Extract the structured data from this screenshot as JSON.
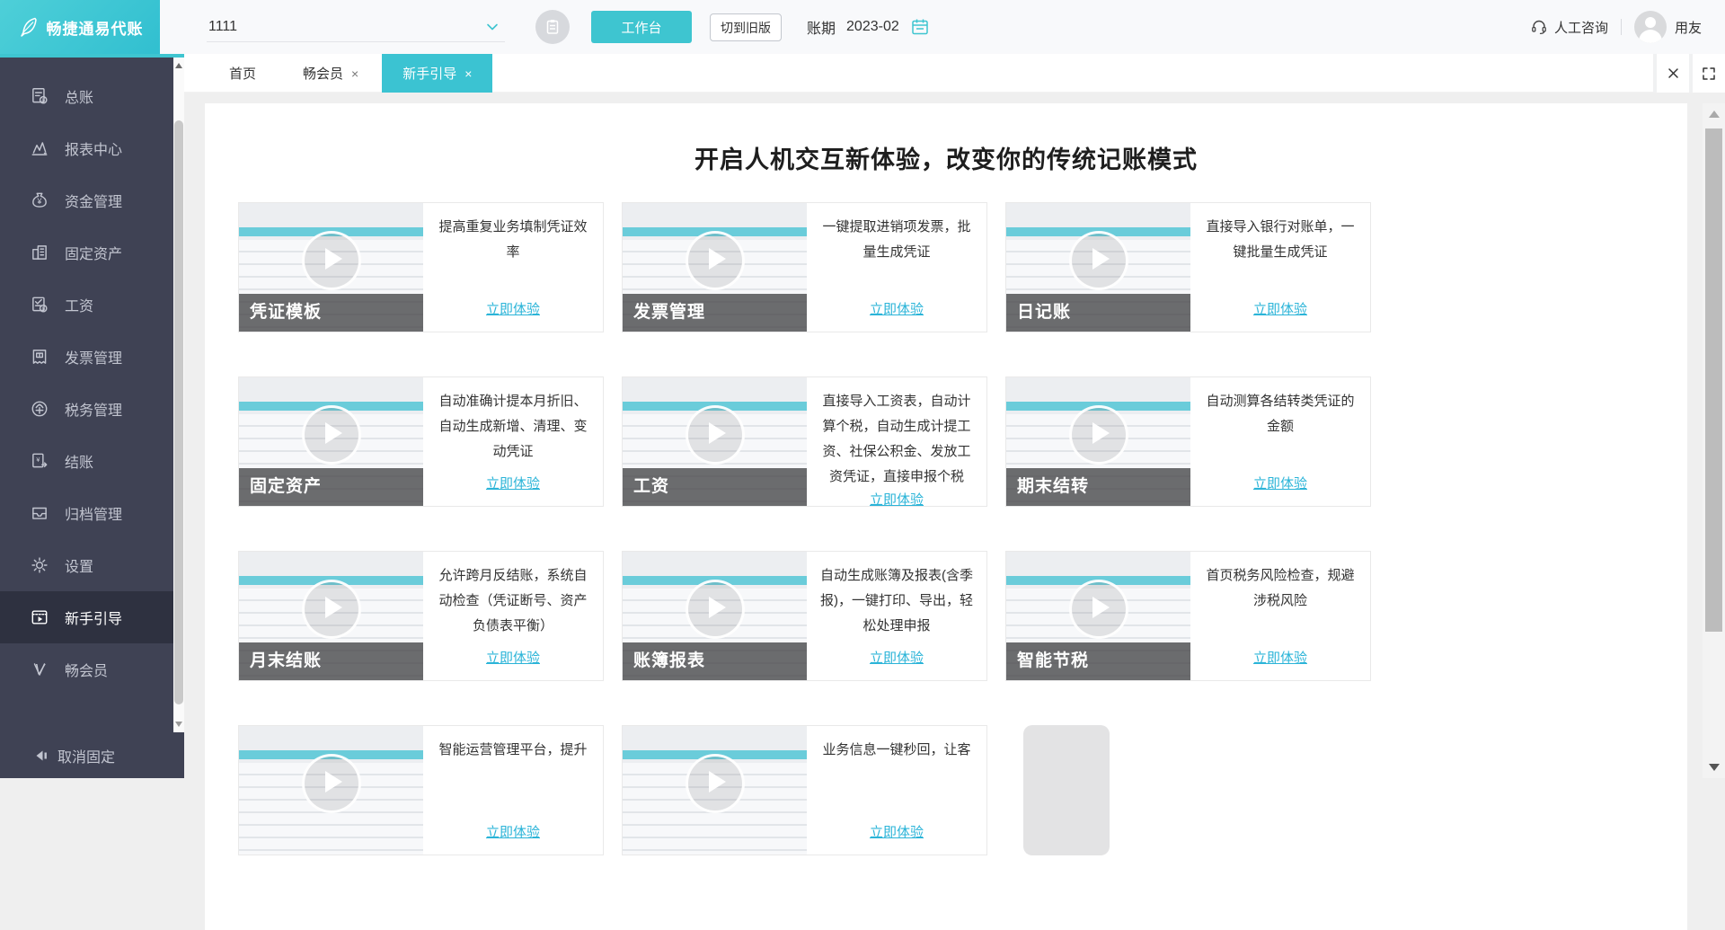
{
  "header": {
    "logo_text": "畅捷通易代账",
    "account": "1111",
    "workbench_label": "工作台",
    "switch_old_label": "切到旧版",
    "period_label": "账期",
    "period_value": "2023-02",
    "support_label": "人工咨询",
    "user_label": "用友"
  },
  "sidebar": {
    "items": [
      {
        "label": "总账",
        "icon": "ledger-icon",
        "active": false
      },
      {
        "label": "报表中心",
        "icon": "report-icon",
        "active": false
      },
      {
        "label": "资金管理",
        "icon": "funds-icon",
        "active": false
      },
      {
        "label": "固定资产",
        "icon": "assets-icon",
        "active": false
      },
      {
        "label": "工资",
        "icon": "salary-icon",
        "active": false
      },
      {
        "label": "发票管理",
        "icon": "invoice-icon",
        "active": false
      },
      {
        "label": "税务管理",
        "icon": "tax-icon",
        "active": false
      },
      {
        "label": "结账",
        "icon": "closing-icon",
        "active": false
      },
      {
        "label": "归档管理",
        "icon": "archive-icon",
        "active": false
      },
      {
        "label": "设置",
        "icon": "settings-icon",
        "active": false
      },
      {
        "label": "新手引导",
        "icon": "guide-icon",
        "active": true
      },
      {
        "label": "畅会员",
        "icon": "member-icon",
        "active": false
      }
    ],
    "unpin_label": "取消固定"
  },
  "tabs": [
    {
      "label": "首页",
      "closable": false,
      "active": false
    },
    {
      "label": "畅会员",
      "closable": true,
      "active": false
    },
    {
      "label": "新手引导",
      "closable": true,
      "active": true
    }
  ],
  "page": {
    "title": "开启人机交互新体验，改变你的传统记账模式",
    "cta_label": "立即体验",
    "cards": [
      {
        "label": "凭证模板",
        "desc": "提高重复业务填制凭证效率"
      },
      {
        "label": "发票管理",
        "desc": "一键提取进销项发票，批量生成凭证"
      },
      {
        "label": "日记账",
        "desc": "直接导入银行对账单，一键批量生成凭证"
      },
      {
        "label": "固定资产",
        "desc": "自动准确计提本月折旧、自动生成新增、清理、变动凭证"
      },
      {
        "label": "工资",
        "desc": "直接导入工资表，自动计算个税，自动生成计提工资、社保公积金、发放工资凭证，直接申报个税"
      },
      {
        "label": "期末结转",
        "desc": "自动测算各结转类凭证的金额"
      },
      {
        "label": "月末结账",
        "desc": "允许跨月反结账，系统自动检查（凭证断号、资产负债表平衡）"
      },
      {
        "label": "账簿报表",
        "desc": "自动生成账簿及报表(含季报)，一键打印、导出，轻松处理申报"
      },
      {
        "label": "智能节税",
        "desc": "首页税务风险检查，规避涉税风险"
      },
      {
        "label": "",
        "desc": "智能运营管理平台，提升",
        "partial": true
      },
      {
        "label": "",
        "desc": "业务信息一键秒回，让客",
        "partial": true
      },
      {
        "label": "",
        "desc": "",
        "placeholder": true
      }
    ]
  },
  "colors": {
    "brand_teal": "#3ec5d0",
    "active_tab": "#3bc3d2",
    "link_teal": "#2bb4d8",
    "sidebar_bg": "#3f4254",
    "sidebar_active_bg": "#2e3140",
    "page_bg": "#efefef"
  }
}
